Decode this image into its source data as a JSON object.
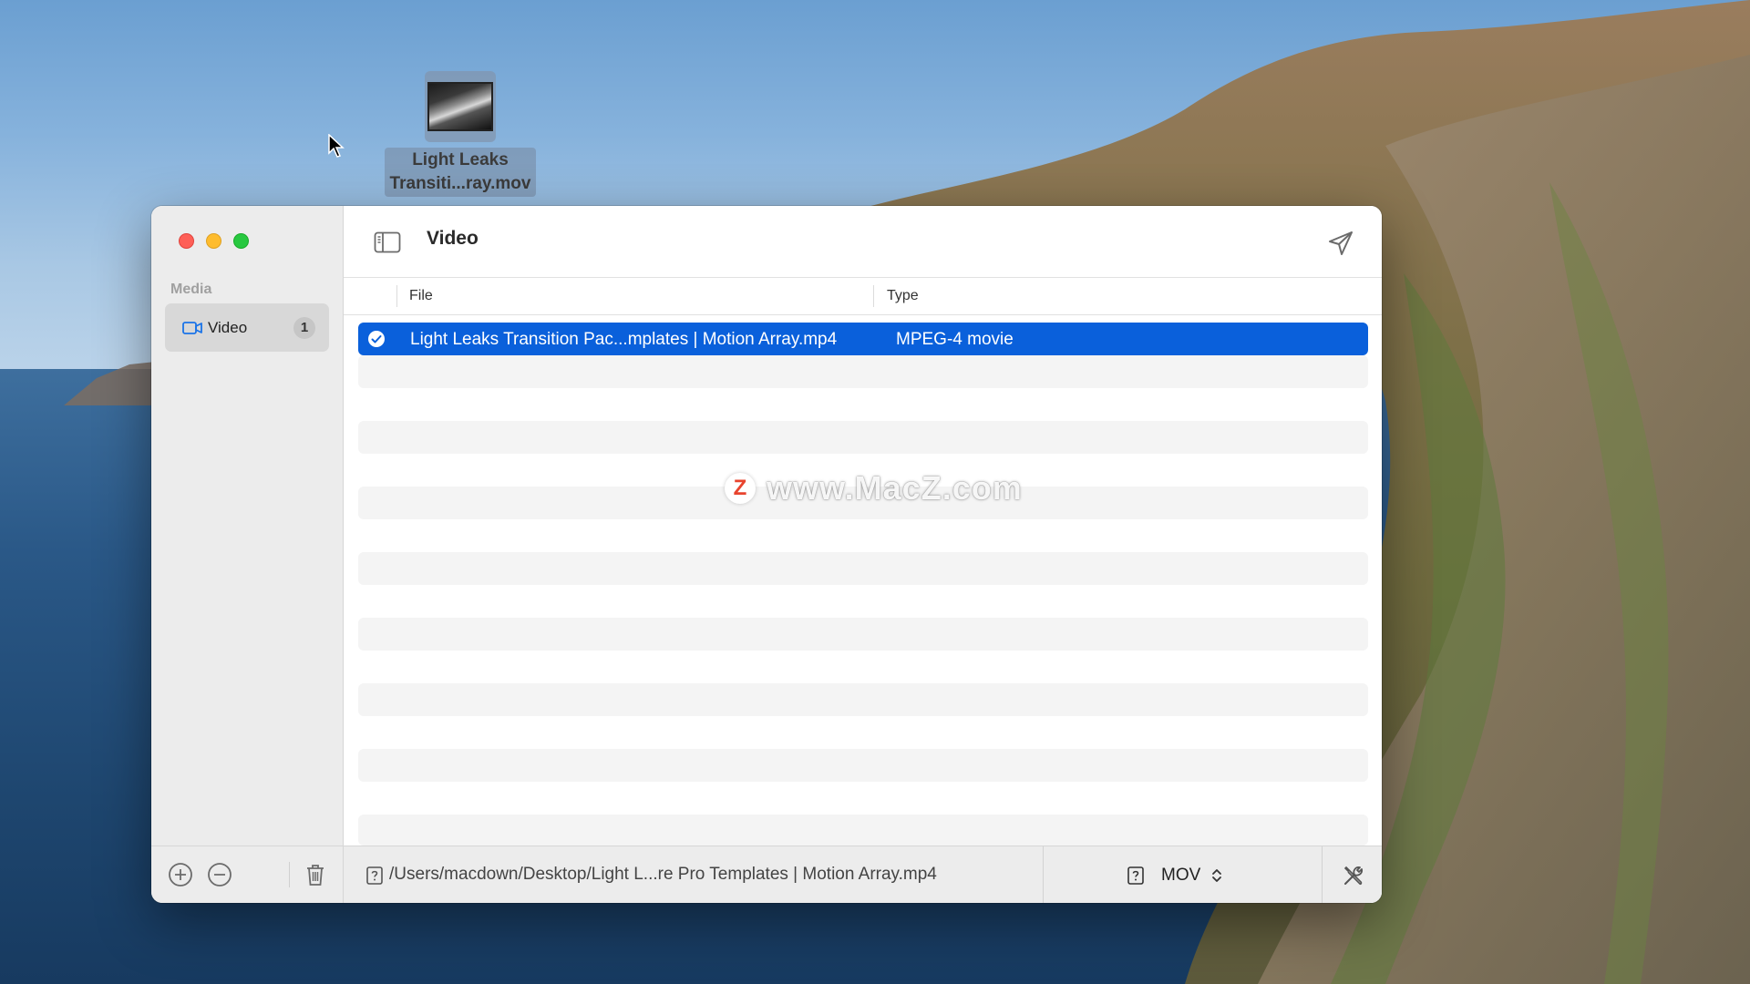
{
  "desktop": {
    "file_label_line1": "Light Leaks",
    "file_label_line2": "Transiti...ray.mov",
    "file_icon": "video-thumbnail-icon",
    "cursor_icon": "arrow-cursor-icon"
  },
  "window": {
    "title": "Video",
    "traffic_lights": {
      "close_color": "#fe5f57",
      "minimize_color": "#febc2e",
      "maximize_color": "#28c840"
    },
    "sidebar": {
      "section_label": "Media",
      "items": [
        {
          "label": "Video",
          "count": "1",
          "icon": "video-camera-icon",
          "selected": true
        }
      ],
      "footer_icons": [
        "add-circle-icon",
        "remove-circle-icon",
        "trash-icon"
      ]
    },
    "toolbar": {
      "toggle_icon": "sidebar-toggle-icon",
      "send_icon": "paper-plane-icon"
    },
    "table": {
      "columns": [
        "File",
        "Type"
      ],
      "rows": [
        {
          "file": "Light Leaks Transition Pac...mplates | Motion Array.mp4",
          "type": "MPEG-4 movie",
          "checked": true,
          "selected": true
        }
      ],
      "selection_color": "#0a60db"
    },
    "status_bar": {
      "path": "/Users/macdown/Desktop/Light L...re Pro Templates | Motion Array.mp4",
      "format": "MOV",
      "settings_icon": "tools-icon"
    }
  },
  "watermark": {
    "logo": "Z",
    "text": "www.MacZ.com"
  }
}
